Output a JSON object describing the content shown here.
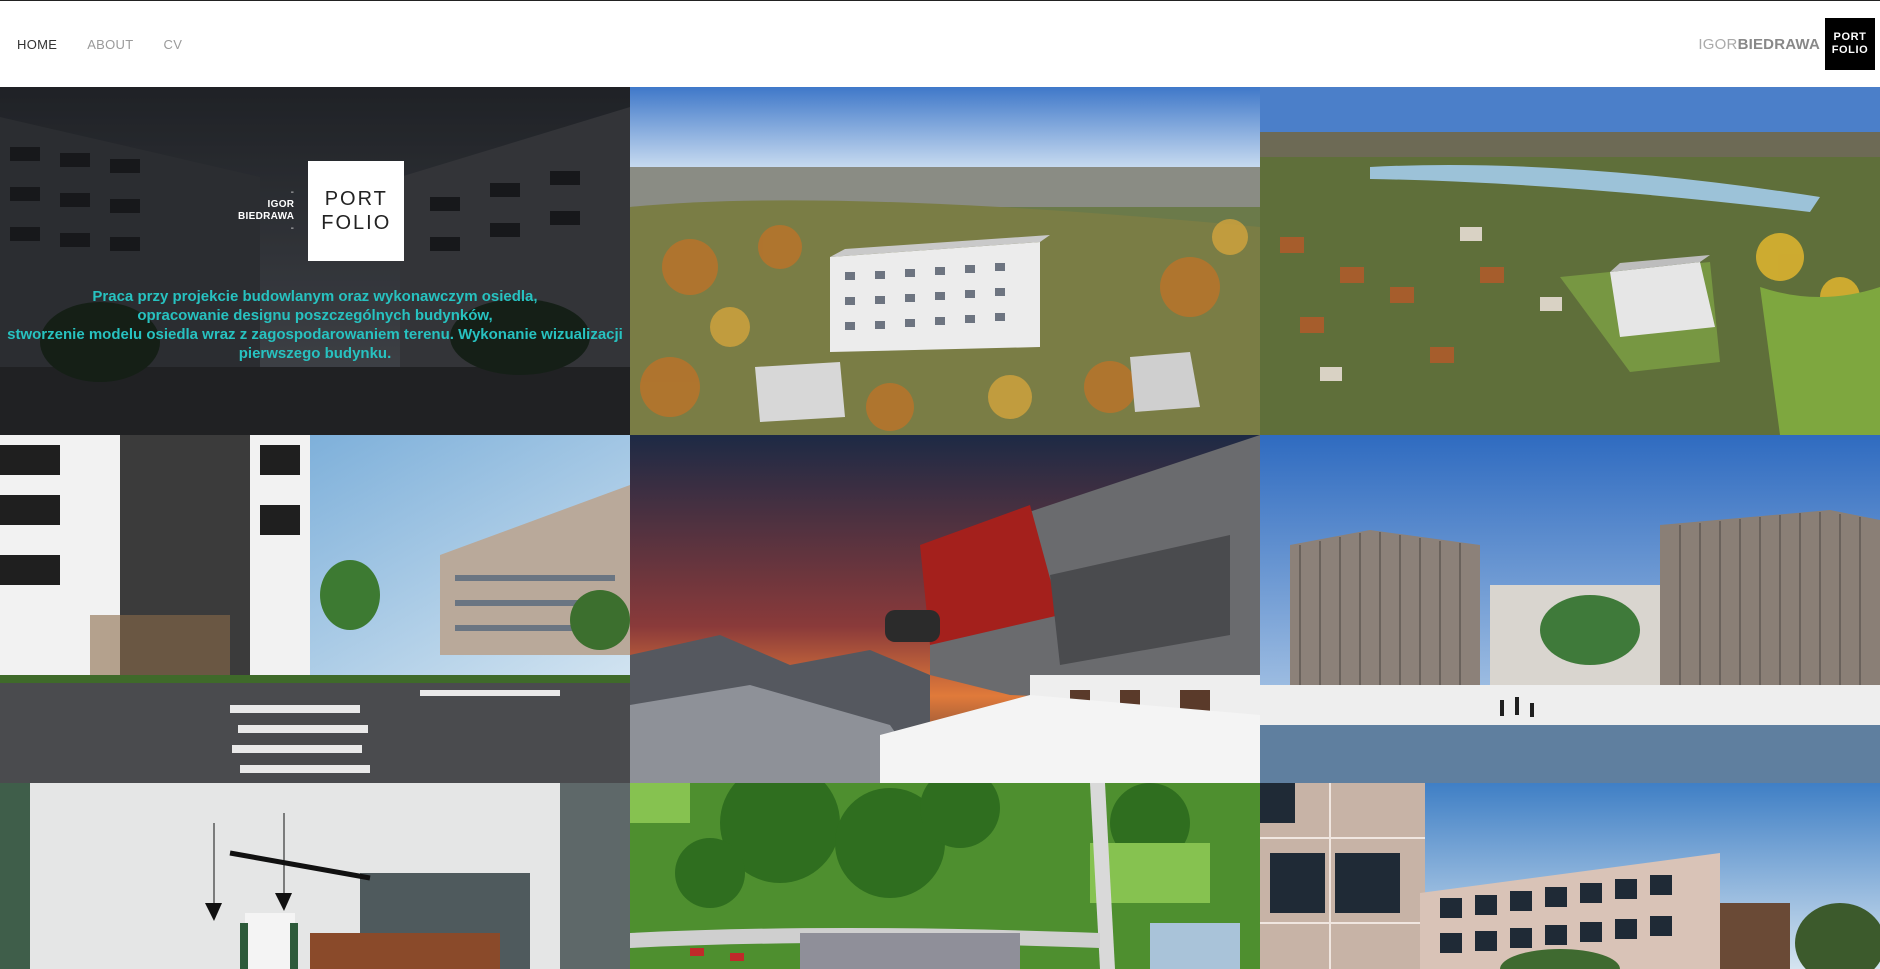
{
  "nav": {
    "items": [
      {
        "label": "HOME",
        "active": true
      },
      {
        "label": "ABOUT",
        "active": false
      },
      {
        "label": "CV",
        "active": false
      }
    ]
  },
  "brand": {
    "first": "IGOR",
    "last": "BIEDRAWA",
    "box_line1": "PORT",
    "box_line2": "FOLIO"
  },
  "hero": {
    "name_line1": "IGOR",
    "name_line2": "BIEDRAWA",
    "box_line1": "PORT",
    "box_line2": "FOLIO",
    "description": "Praca przy projekcie budowlanym oraz wykonawczym osiedla, opracowanie designu poszczególnych budynków, stworzenie modelu osiedla wraz z zagospodarowaniem terenu. Wykonanie wizualizacji pierwszego budynku.",
    "description_lines": [
      "Praca przy projekcie budowlanym oraz wykonawczym osiedla,",
      "opracowanie designu poszczególnych budynków,",
      "stworzenie modelu osiedla wraz z zagospodarowaniem terenu. Wykonanie wizualizacji",
      "pierwszego budynku."
    ]
  },
  "accent_color": "#27c2c0",
  "tiles": [
    {
      "name": "project-tile-1"
    },
    {
      "name": "project-tile-2"
    },
    {
      "name": "project-tile-3"
    },
    {
      "name": "project-tile-4"
    },
    {
      "name": "project-tile-5"
    },
    {
      "name": "project-tile-6"
    },
    {
      "name": "project-tile-7"
    },
    {
      "name": "project-tile-8"
    },
    {
      "name": "project-tile-9"
    }
  ]
}
